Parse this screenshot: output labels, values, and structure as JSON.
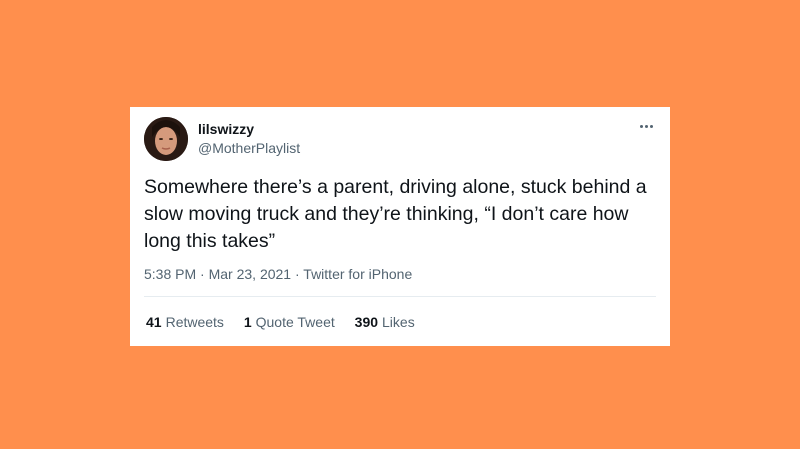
{
  "tweet": {
    "display_name": "lilswizzy",
    "handle": "@MotherPlaylist",
    "text": "Somewhere there’s a parent, driving alone, stuck behind a slow moving truck and they’re thinking, “I don’t care how long this takes”",
    "time": "5:38 PM",
    "date": "Mar 23, 2021",
    "source": "Twitter for iPhone",
    "separator": "·",
    "more_icon": "more-horizontal-icon"
  },
  "stats": {
    "retweets_count": "41",
    "retweets_label": "Retweets",
    "quotes_count": "1",
    "quotes_label": "Quote Tweet",
    "likes_count": "390",
    "likes_label": "Likes"
  },
  "colors": {
    "background": "#ff8f4d",
    "card": "#ffffff",
    "text_primary": "#0f1419",
    "text_secondary": "#536471"
  }
}
